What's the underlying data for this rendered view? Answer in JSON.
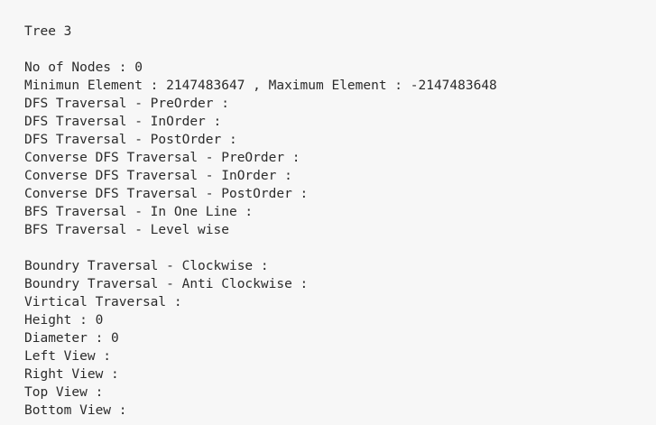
{
  "console": {
    "title": "Tree 3",
    "lines_block1": [
      "No of Nodes : 0",
      "Minimun Element : 2147483647 , Maximum Element : -2147483648",
      "DFS Traversal - PreOrder :",
      "DFS Traversal - InOrder :",
      "DFS Traversal - PostOrder :",
      "Converse DFS Traversal - PreOrder :",
      "Converse DFS Traversal - InOrder :",
      "Converse DFS Traversal - PostOrder :",
      "BFS Traversal - In One Line :",
      "BFS Traversal - Level wise"
    ],
    "lines_block2": [
      "Boundry Traversal - Clockwise :",
      "Boundry Traversal - Anti Clockwise :",
      "Virtical Traversal :",
      "Height : 0",
      "Diameter : 0",
      "Left View :",
      "Right View :",
      "Top View :",
      "Bottom View :"
    ]
  }
}
